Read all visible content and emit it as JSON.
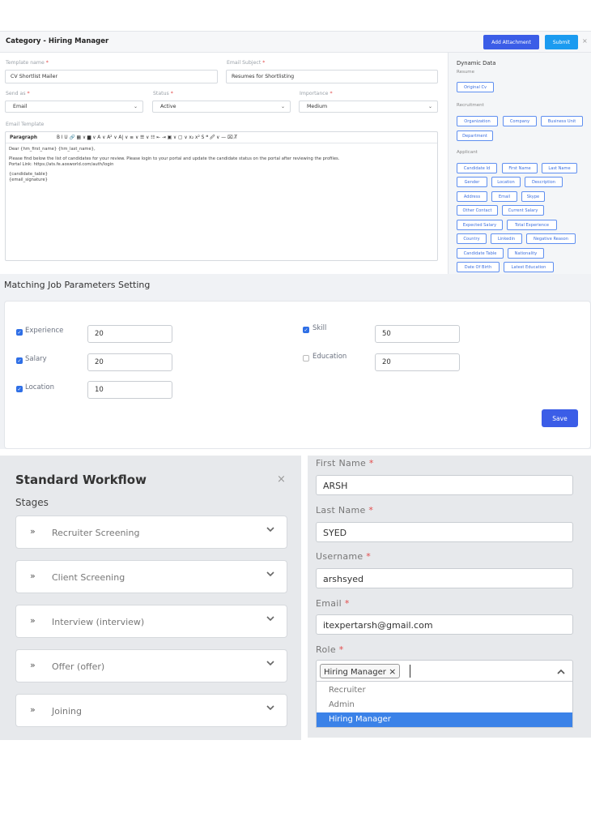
{
  "template": {
    "title": "Category - Hiring Manager",
    "add_attachment": "Add Attachment",
    "submit": "Submit",
    "close": "×",
    "template_name_label": "Template name",
    "template_name_value": "CV Shortlist Mailer",
    "email_subject_label": "Email Subject",
    "email_subject_value": "Resumes for Shortlisting",
    "send_as_label": "Send as",
    "send_as_value": "Email",
    "status_label": "Status",
    "status_value": "Active",
    "importance_label": "Importance",
    "importance_value": "Medium",
    "email_template_label": "Email Template",
    "toolbar_paragraph": "Paragraph",
    "toolbar_glyphs": "B  I  U  🔗  ▦ ∨  ▆ ∨  A ∨  A² ∨  A| ∨  ≡ ∨  ☰ ∨  ☷  ⇤  ⇥  ▣ ∨  ▢ ∨  x₂  x²  S  ❝  🖉 ∨  —  ⌧  T̸",
    "body_line1": "Dear {hm_first_name} {hm_last_name},",
    "body_line2": "Please find below the list of candidates for your review. Please login to your portal and update the candidate status on the portal after reviewing the profiles.",
    "body_line3": "Portal Link: https://ats.fe.aosworld.com/auth/login",
    "body_line4": "{candidate_table}",
    "body_line5": "{email_signature}",
    "dynamic_title": "Dynamic Data",
    "resume_label": "Resume",
    "recruitment_label": "Recruitment",
    "applicant_label": "Applicant",
    "chips_resume": [
      "Original Cv"
    ],
    "chips_recruitment": [
      "Organization",
      "Company",
      "Business Unit",
      "Department"
    ],
    "chips_applicant": [
      "Candidate Id",
      "First Name",
      "Last Name",
      "Gender",
      "Location",
      "Description",
      "Address",
      "Email",
      "Skype",
      "Other Contact",
      "Current Salary",
      "Expected Salary",
      "Total Experience",
      "Country",
      "Linkedin",
      "Negative Reason",
      "Candidate Table",
      "Nationality",
      "Date Of Birth",
      "Latest Education"
    ]
  },
  "matching": {
    "title": "Matching Job Parameters Setting",
    "experience_label": "Experience",
    "experience_value": "20",
    "experience_checked": true,
    "skill_label": "Skill",
    "skill_value": "50",
    "skill_checked": true,
    "salary_label": "Salary",
    "salary_value": "20",
    "salary_checked": true,
    "education_label": "Education",
    "education_value": "20",
    "education_checked": false,
    "location_label": "Location",
    "location_value": "10",
    "location_checked": true,
    "save": "Save"
  },
  "workflow": {
    "title": "Standard Workflow",
    "close": "×",
    "stages_label": "Stages",
    "stages": [
      "Recruiter Screening",
      "Client Screening",
      "Interview (interview)",
      "Offer (offer)",
      "Joining"
    ]
  },
  "user_form": {
    "first_name_label": "First Name",
    "first_name_value": "ARSH",
    "last_name_label": "Last Name",
    "last_name_value": "SYED",
    "username_label": "Username",
    "username_value": "arshsyed",
    "email_label": "Email",
    "email_value": "itexpertarsh@gmail.com",
    "role_label": "Role",
    "role_selected": "Hiring Manager",
    "role_options": [
      "Recruiter",
      "Admin",
      "Hiring Manager"
    ]
  }
}
